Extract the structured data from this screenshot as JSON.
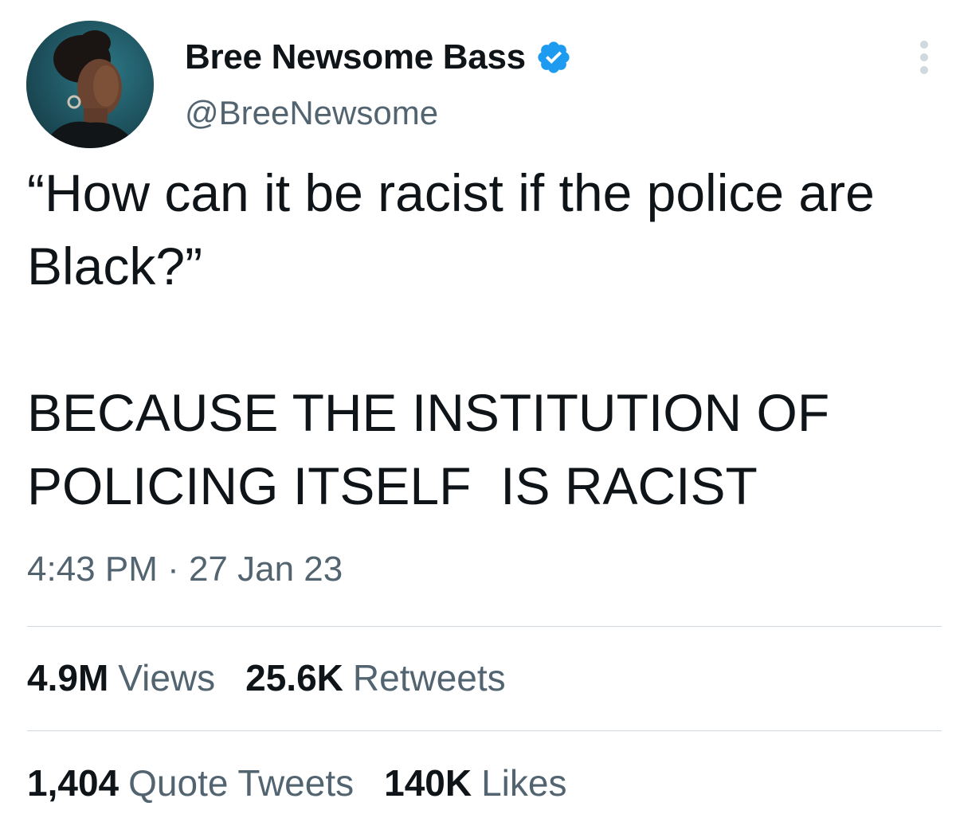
{
  "author": {
    "display_name": "Bree Newsome Bass",
    "handle": "@BreeNewsome",
    "verified": true,
    "avatar": "profile-photo"
  },
  "tweet": {
    "text": "“How can it be racist if the police are Black?”\n\nBECAUSE THE INSTITUTION OF POLICING ITSELF  IS RACIST",
    "timestamp": "4:43 PM · 27 Jan 23"
  },
  "stats": {
    "views": {
      "value": "4.9M",
      "label": "Views"
    },
    "retweets": {
      "value": "25.6K",
      "label": "Retweets"
    },
    "quote_tweets": {
      "value": "1,404",
      "label": "Quote Tweets"
    },
    "likes": {
      "value": "140K",
      "label": "Likes"
    }
  },
  "colors": {
    "text_primary": "#0f1419",
    "text_secondary": "#536471",
    "verified_blue": "#1d9bf0",
    "divider": "#cfd9de"
  },
  "icons": {
    "verified": "verified-badge-icon",
    "more": "more-options-icon"
  }
}
